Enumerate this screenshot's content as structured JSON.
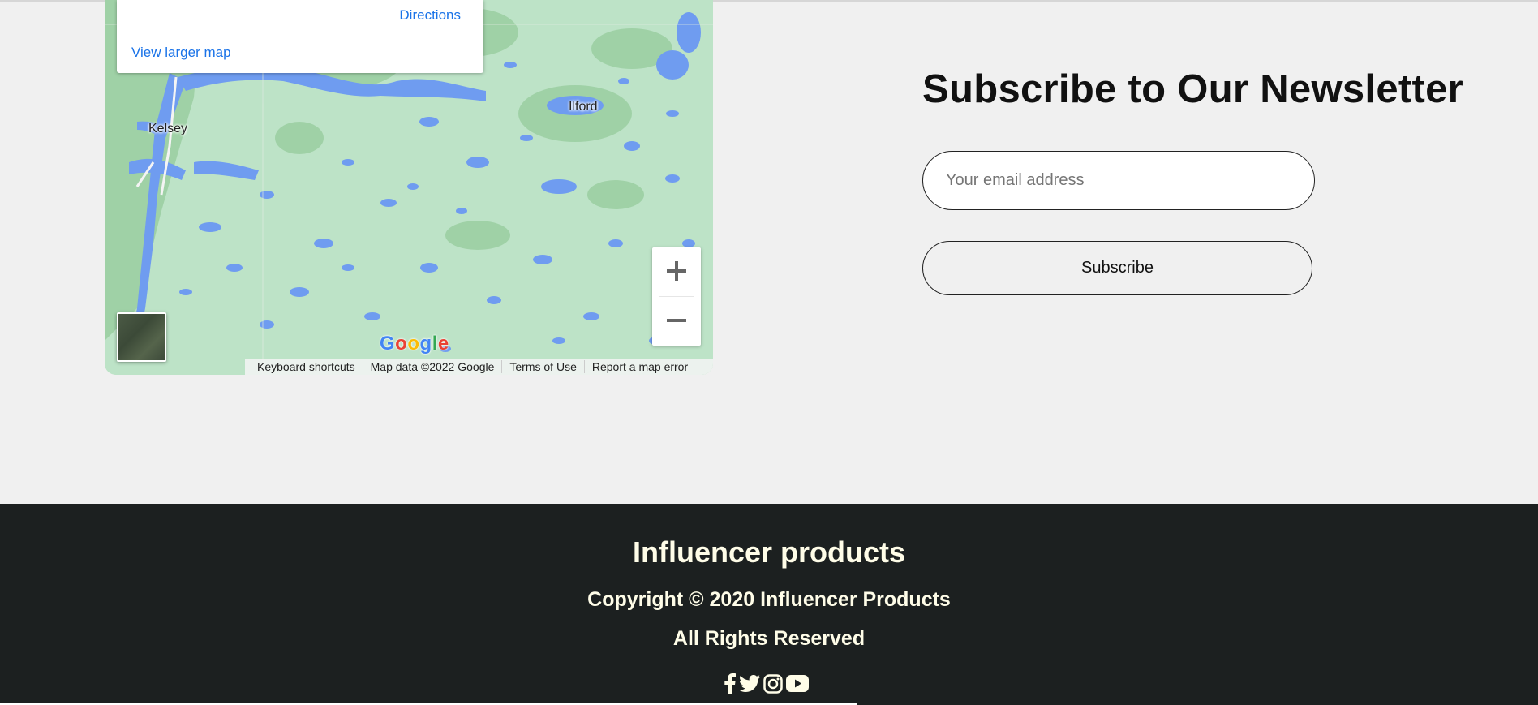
{
  "map": {
    "directions": "Directions",
    "view_larger": "View larger map",
    "labels": {
      "kelsey": "Kelsey",
      "ilford": "Ilford"
    },
    "logo": "Google",
    "attribution": {
      "keyboard": "Keyboard shortcuts",
      "map_data": "Map data ©2022 Google",
      "terms": "Terms of Use",
      "report": "Report a map error"
    },
    "colors": {
      "land": "#bde3c7",
      "water": "#6f9cf0",
      "forest": "#9fd1a6"
    }
  },
  "newsletter": {
    "title": "Subscribe to Our Newsletter",
    "email_placeholder": "Your email address",
    "button": "Subscribe"
  },
  "footer": {
    "brand": "Influencer products",
    "copyright": "Copyright © 2020 Influencer Products",
    "rights": "All Rights Reserved",
    "socials": [
      "facebook-icon",
      "twitter-icon",
      "instagram-icon",
      "youtube-icon"
    ],
    "background": "#1c2020",
    "text_color": "#fffde8"
  }
}
